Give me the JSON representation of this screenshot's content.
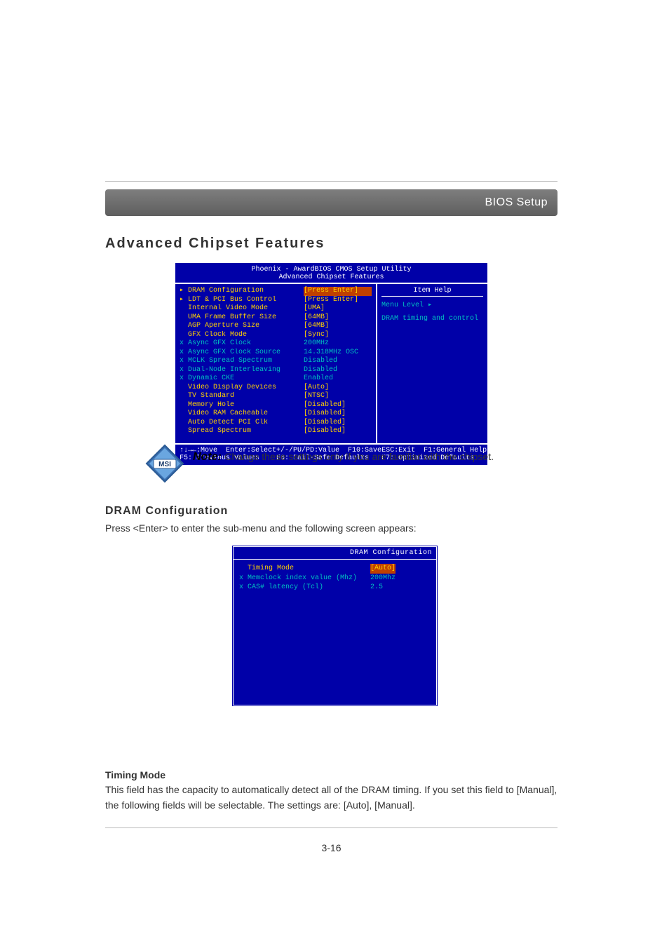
{
  "chapterHeader": "BIOS Setup",
  "h1": "Advanced Chipset Features",
  "bios": {
    "title1": "Phoenix - AwardBIOS CMOS Setup Utility",
    "title2": "Advanced Chipset Features",
    "help_header": "Item Help",
    "menu_level": "Menu Level",
    "help_desc": "DRAM timing and control",
    "rows": [
      {
        "marker": "▸",
        "label": "DRAM Configuration",
        "val": "[Press Enter]",
        "lcls": "yellow",
        "vcls": "yellowbg"
      },
      {
        "marker": "▸",
        "label": "LDT & PCI Bus Control",
        "val": "[Press Enter]",
        "lcls": "yellow",
        "vcls": "yellow"
      },
      {
        "marker": " ",
        "label": "Internal Video Mode",
        "val": "[UMA]",
        "lcls": "yellow",
        "vcls": "yellow"
      },
      {
        "marker": " ",
        "label": "UMA Frame Buffer Size",
        "val": "[64MB]",
        "lcls": "yellow",
        "vcls": "yellow"
      },
      {
        "marker": " ",
        "label": "AGP Aperture Size",
        "val": "[64MB]",
        "lcls": "yellow",
        "vcls": "yellow"
      },
      {
        "marker": " ",
        "label": "GFX Clock Mode",
        "val": "[Sync]",
        "lcls": "yellow",
        "vcls": "yellow"
      },
      {
        "marker": "x",
        "label": "Async GFX Clock",
        "val": "200MHz",
        "lcls": "cyan",
        "vcls": "cyan"
      },
      {
        "marker": "x",
        "label": "Async GFX Clock Source",
        "val": "14.318MHz OSC",
        "lcls": "cyan",
        "vcls": "cyan"
      },
      {
        "marker": "x",
        "label": "MCLK Spread Spectrum",
        "val": "Disabled",
        "lcls": "cyan",
        "vcls": "cyan"
      },
      {
        "marker": "x",
        "label": "Dual-Node Interleaving",
        "val": "Disabled",
        "lcls": "cyan",
        "vcls": "cyan"
      },
      {
        "marker": "x",
        "label": "Dynamic CKE",
        "val": "Enabled",
        "lcls": "cyan",
        "vcls": "cyan"
      },
      {
        "marker": " ",
        "label": "Video Display Devices",
        "val": "[Auto]",
        "lcls": "yellow",
        "vcls": "yellow"
      },
      {
        "marker": " ",
        "label": "TV Standard",
        "val": "[NTSC]",
        "lcls": "yellow",
        "vcls": "yellow"
      },
      {
        "marker": " ",
        "label": "Memory Hole",
        "val": "[Disabled]",
        "lcls": "yellow",
        "vcls": "yellow"
      },
      {
        "marker": " ",
        "label": "Video RAM Cacheable",
        "val": "[Disabled]",
        "lcls": "yellow",
        "vcls": "yellow"
      },
      {
        "marker": " ",
        "label": "Auto Detect PCI Clk",
        "val": "[Disabled]",
        "lcls": "yellow",
        "vcls": "yellow"
      },
      {
        "marker": " ",
        "label": "Spread Spectrum",
        "val": "[Disabled]",
        "lcls": "yellow",
        "vcls": "yellow"
      }
    ],
    "footer": {
      "c1a": "↑↓→←:Move  Enter:Select",
      "c1b": "F5: Previous Values",
      "c2a": "+/-/PU/PD:Value  F10:Save",
      "c2b": "F6: Fail-Safe Defaults",
      "c3a": "ESC:Exit  F1:General Help",
      "c3b": "F7: Optimized Defaults"
    }
  },
  "logo_text": "MSI",
  "noteHeading": "Note:",
  "noteBody": "Change these settings only if you are familiar with the chipset.",
  "h2": "DRAM Configuration",
  "p1": "Press <Enter> to enter the sub-menu and the following screen appears:",
  "bios2": {
    "header": "DRAM Configuration",
    "rows": [
      {
        "marker": " ",
        "label": "Timing Mode",
        "val": "[Auto]",
        "lcls": "yellow",
        "vcls": "yellowbg"
      },
      {
        "marker": "x",
        "label": "Memclock index value (Mhz)",
        "val": "200Mhz",
        "lcls": "cyan",
        "vcls": "cyan"
      },
      {
        "marker": "x",
        "label": "CAS# latency (Tcl)",
        "val": "2.5",
        "lcls": "cyan",
        "vcls": "cyan"
      }
    ]
  },
  "sub1": "Timing Mode",
  "sub1_body": "This field has the capacity to automatically detect all of the DRAM timing. If you set this field to [Manual], the following fields will be selectable.  The settings are: [Auto], [Manual].",
  "pageNum": "3-16"
}
